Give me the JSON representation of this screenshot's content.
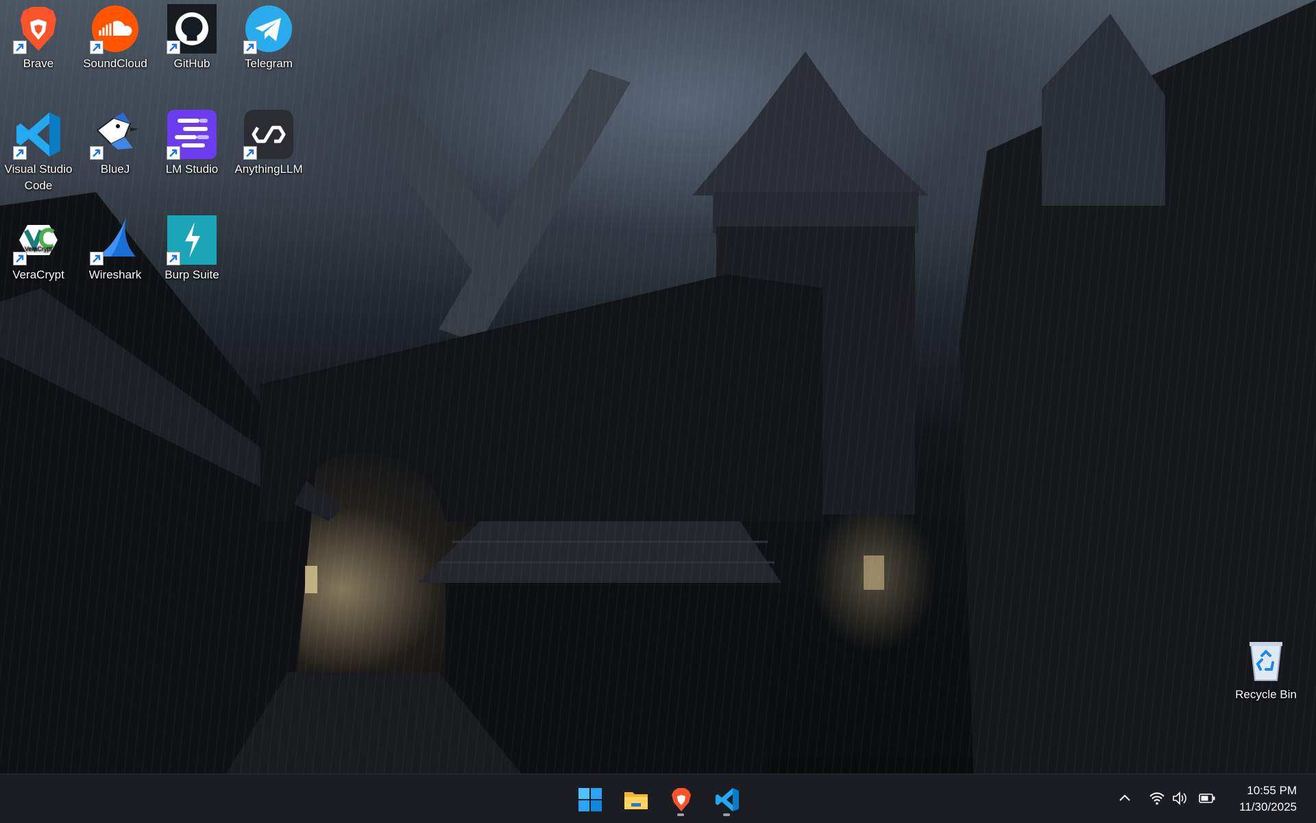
{
  "desktop": {
    "icons": [
      {
        "label": "Brave",
        "icon": "brave-icon"
      },
      {
        "label": "SoundCloud",
        "icon": "soundcloud-icon"
      },
      {
        "label": "GitHub",
        "icon": "github-icon"
      },
      {
        "label": "Telegram",
        "icon": "telegram-icon"
      },
      {
        "label": "Visual Studio Code",
        "icon": "vscode-icon"
      },
      {
        "label": "BlueJ",
        "icon": "bluej-icon"
      },
      {
        "label": "LM Studio",
        "icon": "lm-studio-icon"
      },
      {
        "label": "AnythingLLM",
        "icon": "anythingllm-icon"
      },
      {
        "label": "VeraCrypt",
        "icon": "veracrypt-icon",
        "badge": "VeraCrypt"
      },
      {
        "label": "Wireshark",
        "icon": "wireshark-icon"
      },
      {
        "label": "Burp Suite",
        "icon": "burp-suite-icon"
      }
    ],
    "recycle_bin": {
      "label": "Recycle Bin",
      "icon": "recycle-bin-icon"
    }
  },
  "taskbar": {
    "apps": [
      {
        "name": "Start",
        "icon": "windows-start-icon",
        "running": false
      },
      {
        "name": "File Explorer",
        "icon": "file-explorer-icon",
        "running": false
      },
      {
        "name": "Brave",
        "icon": "brave-icon",
        "running": true
      },
      {
        "name": "Visual Studio Code",
        "icon": "vscode-icon",
        "running": true
      }
    ],
    "tray": {
      "icons": [
        "chevron-up-icon",
        "wifi-icon",
        "volume-icon",
        "battery-icon"
      ]
    },
    "clock": {
      "time": "10:55 PM",
      "date": "11/30/2025"
    }
  },
  "colors": {
    "taskbar_bg": "#1c1d22",
    "brave_orange": "#fb542b",
    "vscode_blue": "#23a9f2",
    "telegram_blue": "#2aabee",
    "soundcloud_orange": "#ff5500",
    "burp_teal": "#1aa6b7",
    "lmstudio_purple": "#6d3cf0"
  }
}
